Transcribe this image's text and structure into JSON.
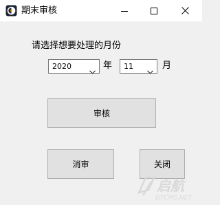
{
  "window": {
    "title": "期末审核",
    "controls": {
      "minimize_icon": "minimize-icon",
      "maximize_icon": "maximize-icon",
      "close_icon": "close-icon"
    }
  },
  "form": {
    "prompt": "请选择想要处理的月份",
    "year": {
      "selected": "2020",
      "unit": "年"
    },
    "month": {
      "selected": "11",
      "unit": "月"
    }
  },
  "buttons": {
    "audit": "审核",
    "cancel_audit": "消审",
    "close": "关闭"
  },
  "watermark": {
    "brand": "启航",
    "site": "DTCMS.NET"
  },
  "colors": {
    "window_bg": "#f0f0f0",
    "titlebar_bg": "#ffffff",
    "button_bg": "#e1e1e1",
    "button_border": "#adadad",
    "watermark": "#d9d9d9"
  }
}
